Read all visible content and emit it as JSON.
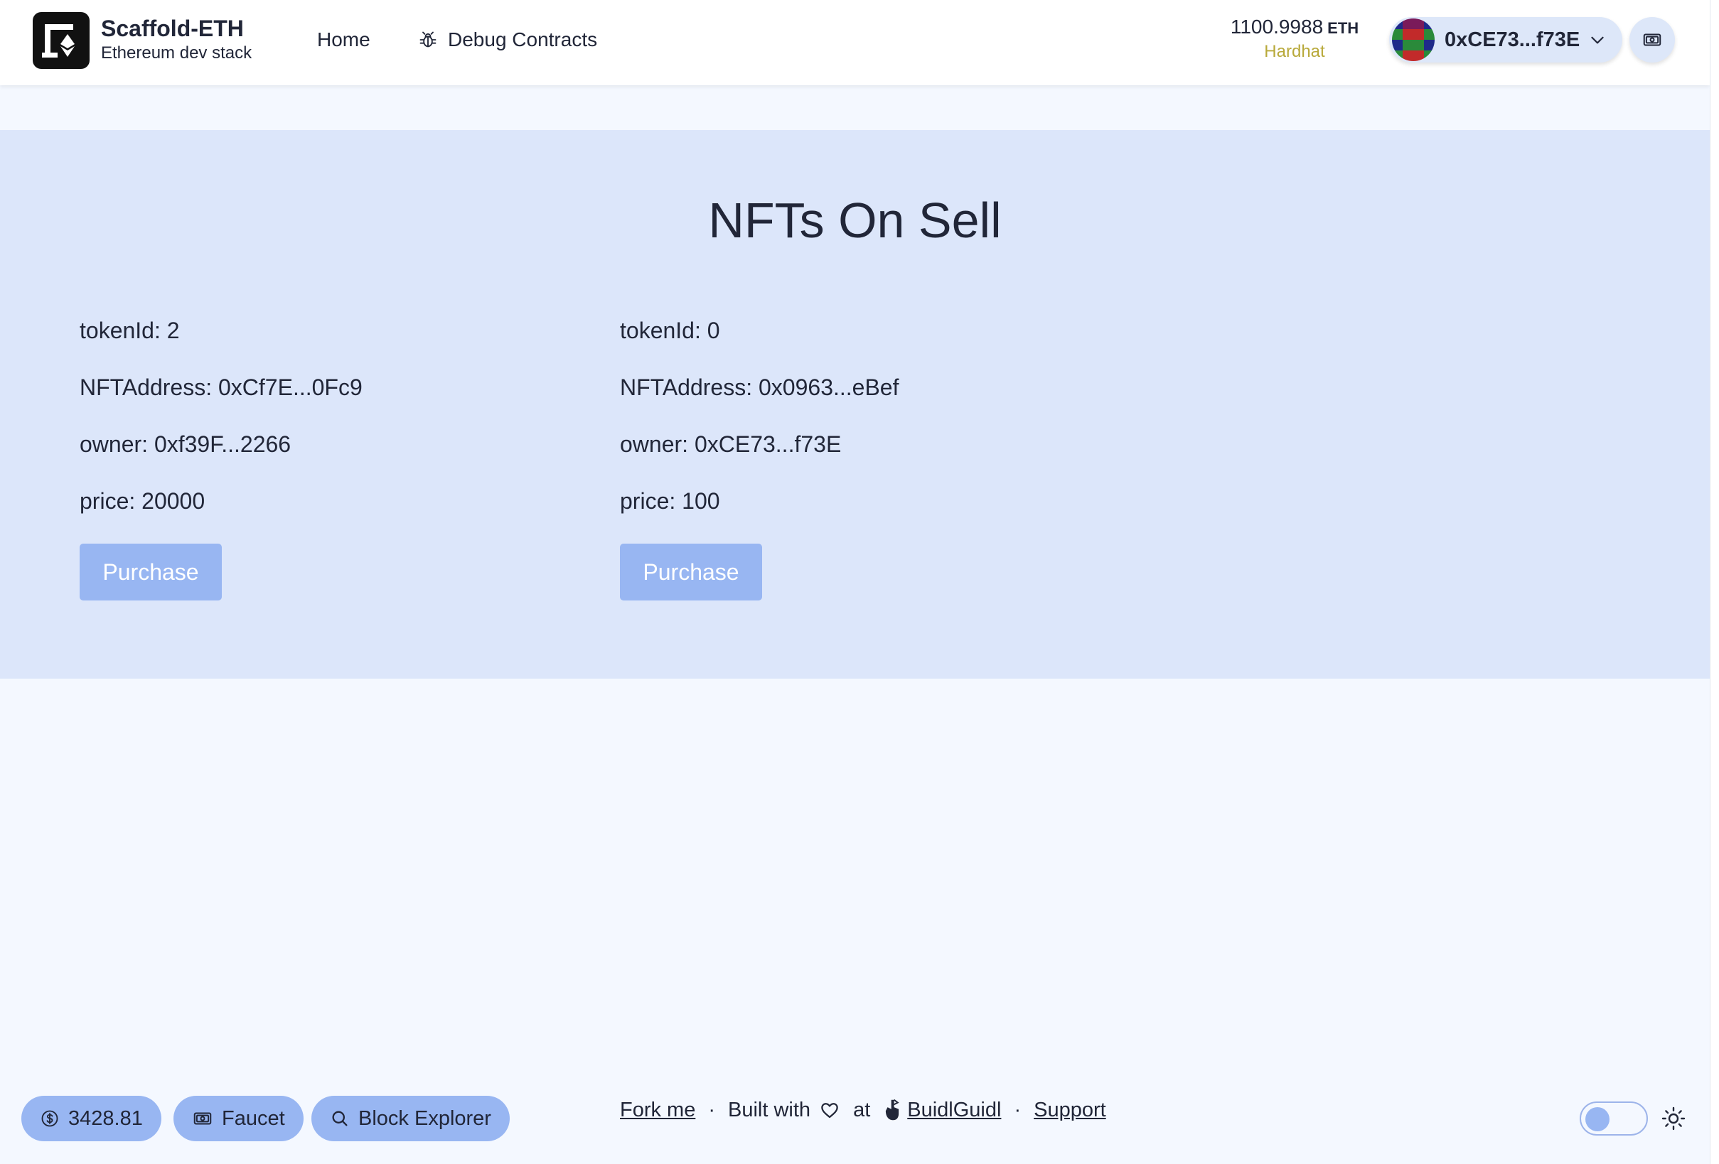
{
  "header": {
    "brand_title": "Scaffold-ETH",
    "brand_subtitle": "Ethereum dev stack",
    "nav": [
      {
        "label": "Home"
      },
      {
        "label": "Debug Contracts"
      }
    ],
    "balance": {
      "amount": "1100.9988",
      "unit": "ETH",
      "network": "Hardhat"
    },
    "address": "0xCE73...f73E"
  },
  "main": {
    "title": "NFTs On Sell",
    "cards": [
      {
        "token_id": "tokenId: 2",
        "nft_address": "NFTAddress: 0xCf7E...0Fc9",
        "owner": "owner: 0xf39F...2266",
        "price": "price: 20000",
        "button": "Purchase"
      },
      {
        "token_id": "tokenId: 0",
        "nft_address": "NFTAddress: 0x0963...eBef",
        "owner": "owner: 0xCE73...f73E",
        "price": "price: 100",
        "button": "Purchase"
      }
    ]
  },
  "footer": {
    "eth_price": "3428.81",
    "faucet": "Faucet",
    "block_explorer": "Block Explorer",
    "fork_me": "Fork me",
    "sep": "·",
    "built_with": "Built with",
    "at": "at",
    "buidlguidl": "BuidlGuidl",
    "support": "Support"
  },
  "colors": {
    "accent": "#98b6f2",
    "band": "#dce6fa",
    "background": "#f4f8ff",
    "network": "#b8a93a"
  }
}
